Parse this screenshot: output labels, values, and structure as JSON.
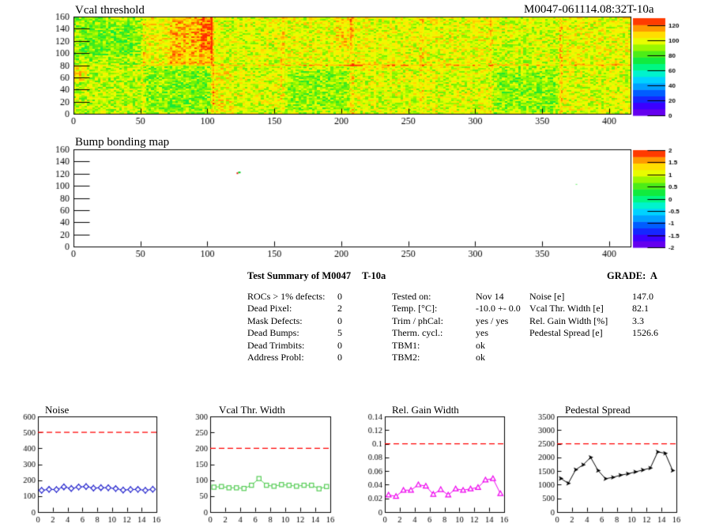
{
  "header": {
    "module_id": "M0047-061114.08:32T-10a"
  },
  "summary": {
    "title": "Test Summary of M0047",
    "subtitle": "T-10a",
    "grade": "GRADE:  A",
    "left_rows": [
      {
        "label": "ROCs > 1% defects:",
        "value": "0"
      },
      {
        "label": "Dead Pixel:",
        "value": "2"
      },
      {
        "label": "Mask Defects:",
        "value": "0"
      },
      {
        "label": "Dead Bumps:",
        "value": "5"
      },
      {
        "label": "Dead Trimbits:",
        "value": "0"
      },
      {
        "label": "Address Probl:",
        "value": "0"
      }
    ],
    "mid_rows": [
      {
        "label": "Tested on:",
        "value": "Nov 14"
      },
      {
        "label": "Temp. [°C]:",
        "value": "-10.0 +- 0.0"
      },
      {
        "label": "Trim / phCal:",
        "value": "yes / yes"
      },
      {
        "label": "Therm. cycl.:",
        "value": "yes"
      },
      {
        "label": "TBM1:",
        "value": "ok"
      },
      {
        "label": "TBM2:",
        "value": "ok"
      }
    ],
    "right_rows": [
      {
        "label": "Noise [e]",
        "value": "147.0"
      },
      {
        "label": "Vcal Thr. Width [e]",
        "value": "82.1"
      },
      {
        "label": "Rel. Gain Width [%]",
        "value": "3.3"
      },
      {
        "label": "Pedestal Spread [e]",
        "value": "1526.6"
      }
    ]
  },
  "colors": {
    "cut_line": "#ff0000",
    "noise_series": "#2323cc",
    "vcal_series": "#55cc55",
    "relgain_series": "#ee00ee",
    "pedestal_series": "#000000",
    "palette": [
      [
        0,
        "#7a00e6"
      ],
      [
        0.1,
        "#3c00ff"
      ],
      [
        0.2,
        "#003cff"
      ],
      [
        0.3,
        "#00a0ff"
      ],
      [
        0.38,
        "#00dcff"
      ],
      [
        0.46,
        "#00ffb4"
      ],
      [
        0.54,
        "#00f050"
      ],
      [
        0.6,
        "#28e628"
      ],
      [
        0.68,
        "#82f500"
      ],
      [
        0.76,
        "#e6ff00"
      ],
      [
        0.82,
        "#ffeb00"
      ],
      [
        0.88,
        "#ffb400"
      ],
      [
        0.94,
        "#ff6400"
      ],
      [
        1,
        "#ff0a00"
      ]
    ]
  },
  "chart_data": [
    {
      "type": "heatmap",
      "title": "Vcal threshold",
      "xlim": [
        0,
        416
      ],
      "ylim": [
        0,
        160
      ],
      "x_ticks": [
        0,
        50,
        100,
        150,
        200,
        250,
        300,
        350,
        400
      ],
      "y_ticks": [
        0,
        20,
        40,
        60,
        80,
        100,
        120,
        140,
        160
      ],
      "zlim": [
        0,
        130
      ],
      "z_ticks": [
        0,
        20,
        40,
        60,
        80,
        100,
        120
      ],
      "texture": {
        "base": 100,
        "roc_w": 52,
        "row_offsets": [
          [
            -7,
            4,
            0,
            2,
            1,
            2,
            -1,
            2
          ],
          [
            -4,
            -7,
            0,
            -3,
            0,
            0,
            -6,
            0
          ]
        ],
        "boundaries": [
          52,
          104,
          156,
          208,
          260,
          312,
          364
        ],
        "boundary_dv": 7,
        "hot_boundaries": {
          "104": 11,
          "208": 9,
          "364": 11
        },
        "noise_amp": 8,
        "speckle": {
          "p_hot_top": 0.06,
          "p_hot_bottom": 0.04,
          "dv_hot": 12,
          "p_cold": 0.05,
          "dv_cold": -11
        },
        "features": [
          [
            4,
            44,
            96,
            148,
            -6
          ],
          [
            72,
            104,
            82,
            160,
            9
          ],
          [
            95,
            104,
            105,
            160,
            12
          ],
          [
            0,
            10,
            52,
            78,
            12
          ],
          [
            104,
            118,
            0,
            78,
            5
          ],
          [
            196,
            208,
            105,
            160,
            6
          ],
          [
            160,
            206,
            6,
            70,
            -6
          ],
          [
            55,
            102,
            8,
            70,
            -4
          ],
          [
            316,
            360,
            8,
            68,
            -4
          ],
          [
            208,
            240,
            72,
            86,
            5
          ]
        ],
        "hline": {
          "y": 80,
          "halo": 2.6,
          "core": 1.3,
          "dv_halo_right": 6,
          "dv_halo_left": 2,
          "dv_core_right": 8,
          "dv_core_left": 4
        }
      }
    },
    {
      "type": "heatmap",
      "title": "Bump bonding map",
      "xlim": [
        0,
        416
      ],
      "ylim": [
        0,
        160
      ],
      "x_ticks": [
        0,
        50,
        100,
        150,
        200,
        250,
        300,
        350,
        400
      ],
      "y_ticks": [
        0,
        20,
        40,
        60,
        80,
        100,
        120,
        140,
        160
      ],
      "zlim": [
        -2,
        2
      ],
      "z_ticks": [
        2,
        1.5,
        1,
        0.5,
        0,
        -0.5,
        -1,
        -1.5,
        -2
      ],
      "defects": [
        {
          "x": 123,
          "y": 122,
          "style": "red-green"
        },
        {
          "x": 375,
          "y": 103,
          "style": "green"
        }
      ]
    },
    {
      "type": "line",
      "title": "Noise",
      "x_note": "ROC index + 0.5",
      "xlim": [
        0,
        16
      ],
      "x_ticks": [
        0,
        2,
        4,
        6,
        8,
        10,
        12,
        14,
        16
      ],
      "ylim": [
        0,
        600
      ],
      "y_ticks": [
        0,
        100,
        200,
        300,
        400,
        500,
        600
      ],
      "cut_line": 500,
      "marker": "diamond",
      "color_key": "noise_series",
      "error": 12,
      "values": [
        136,
        142,
        141,
        158,
        148,
        157,
        160,
        150,
        153,
        152,
        147,
        138,
        141,
        142,
        136,
        143
      ]
    },
    {
      "type": "line",
      "title": "Vcal Thr. Width",
      "x_note": "ROC index + 0.5",
      "xlim": [
        0,
        16
      ],
      "x_ticks": [
        0,
        2,
        4,
        6,
        8,
        10,
        12,
        14,
        16
      ],
      "ylim": [
        0,
        300
      ],
      "y_ticks": [
        0,
        50,
        100,
        150,
        200,
        250,
        300
      ],
      "cut_line": 200,
      "marker": "square",
      "color_key": "vcal_series",
      "values": [
        78,
        80,
        76,
        76,
        74,
        84,
        105,
        84,
        81,
        86,
        84,
        81,
        84,
        84,
        73,
        80
      ]
    },
    {
      "type": "line",
      "title": "Rel. Gain Width",
      "x_note": "ROC index + 0.5",
      "xlim": [
        0,
        16
      ],
      "x_ticks": [
        0,
        2,
        4,
        6,
        8,
        10,
        12,
        14,
        16
      ],
      "ylim": [
        0,
        0.14
      ],
      "y_ticks": [
        0,
        0.02,
        0.04,
        0.06,
        0.08,
        0.1,
        0.12,
        0.14
      ],
      "cut_line": 0.1,
      "marker": "triangle",
      "color_key": "relgain_series",
      "values": [
        0.025,
        0.023,
        0.032,
        0.032,
        0.04,
        0.038,
        0.026,
        0.033,
        0.025,
        0.034,
        0.032,
        0.034,
        0.036,
        0.047,
        0.049,
        0.027
      ]
    },
    {
      "type": "line",
      "title": "Pedestal Spread",
      "x_note": "ROC index + 0.5",
      "xlim": [
        0,
        16
      ],
      "x_ticks": [
        0,
        2,
        4,
        6,
        8,
        10,
        12,
        14,
        16
      ],
      "ylim": [
        0,
        3500
      ],
      "y_ticks": [
        0,
        500,
        1000,
        1500,
        2000,
        2500,
        3000,
        3500
      ],
      "cut_line": 2500,
      "marker": "arrow",
      "color_key": "pedestal_series",
      "values": [
        1230,
        1050,
        1550,
        1730,
        2000,
        1520,
        1220,
        1270,
        1350,
        1400,
        1470,
        1540,
        1610,
        2200,
        2150,
        1520
      ]
    }
  ]
}
